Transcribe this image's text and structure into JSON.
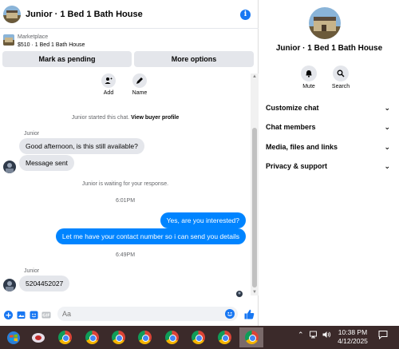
{
  "header": {
    "title": "Junior · 1 Bed 1 Bath House",
    "info_icon": "info-icon"
  },
  "listing": {
    "source": "Marketplace",
    "price_title": "$510 · 1 Bed 1 Bath House",
    "mark_pending_label": "Mark as pending",
    "more_options_label": "More options"
  },
  "actions": [
    {
      "label": "Add",
      "icon": "add-person-icon"
    },
    {
      "label": "Name",
      "icon": "pencil-icon"
    }
  ],
  "messages": {
    "started_text": "Junior started this chat.",
    "view_profile_link": "View buyer profile",
    "sender_name_1": "Junior",
    "bubble_1": "Good afternoon, is this still available?",
    "bubble_2": "Message sent",
    "waiting_text": "Junior is waiting for your response.",
    "time_1": "6:01PM",
    "out_1": "Yes, are you interested?",
    "out_2": "Let me have your contact number so i can send you details",
    "time_2": "6:49PM",
    "sender_name_2": "Junior",
    "bubble_3": "5204452027"
  },
  "composer": {
    "placeholder": "Aa",
    "icons": [
      "plus-icon",
      "image-icon",
      "sticker-icon",
      "gif-icon",
      "emoji-icon",
      "thumbs-up-icon"
    ]
  },
  "right_panel": {
    "title": "Junior · 1 Bed 1 Bath House",
    "mute_label": "Mute",
    "search_label": "Search",
    "menu": [
      "Customize chat",
      "Chat members",
      "Media, files and links",
      "Privacy & support"
    ]
  },
  "taskbar": {
    "time": "10:38 PM",
    "date": "4/12/2025"
  },
  "colors": {
    "accent": "#0084ff",
    "brand": "#1877f2",
    "bubble_in": "#e4e6eb",
    "taskbar": "#3b2a2a"
  }
}
